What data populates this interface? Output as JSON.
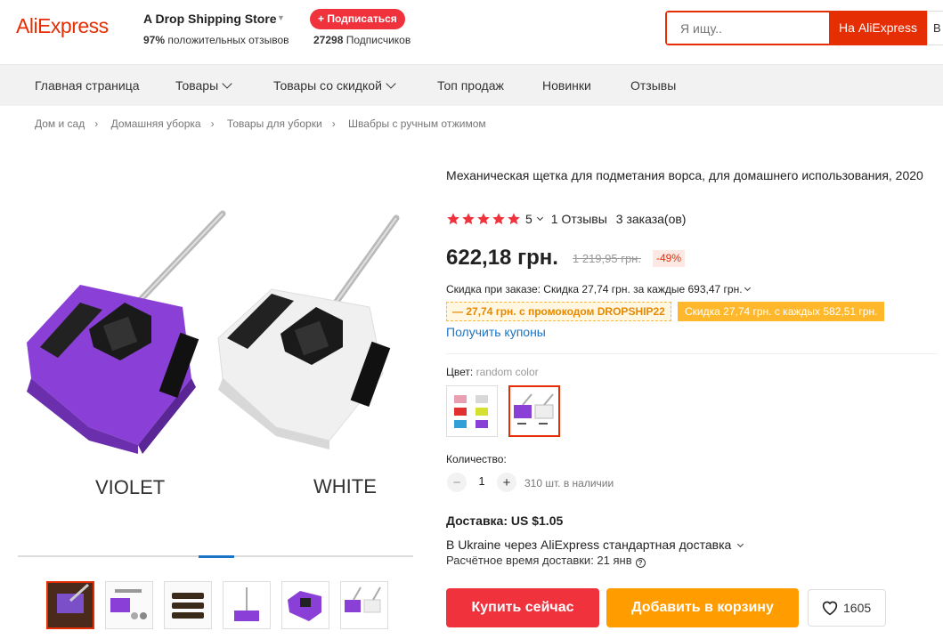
{
  "header": {
    "logo": "AliExpress",
    "store_name": "A Drop Shipping Store",
    "rating_pct": "97%",
    "rating_text": "положительных отзывов",
    "subscribe_label": "+ Подписаться",
    "subscribers_count": "27298",
    "subscribers_text": "Подписчиков",
    "search_placeholder": "Я ищу..",
    "search_button": "На AliExpress",
    "search_button2": "В"
  },
  "nav": {
    "items": [
      "Главная страница",
      "Товары",
      "Товары со скидкой",
      "Топ продаж",
      "Новинки",
      "Отзывы"
    ]
  },
  "breadcrumb": [
    "Дом и сад",
    "Домашняя уборка",
    "Товары для уборки",
    "Швабры с ручным отжимом"
  ],
  "gallery": {
    "main_label_left": "VIOLET",
    "main_label_right": "WHITE",
    "colors": {
      "violet": "#8a3fd6",
      "white": "#f2f2f2"
    }
  },
  "product": {
    "title": "Механическая щетка для подметания ворса, для домашнего использования, 2020",
    "rating": "5",
    "reviews": "1 Отзывы",
    "orders": "3 заказа(ов)",
    "price": "622,18 грн.",
    "old_price": "1 219,95 грн.",
    "discount": "-49%",
    "order_discount": "Скидка при заказе: Скидка 27,74 грн. за каждые 693,47 грн.",
    "promo_code": "— 27,74 грн. с промокодом DROPSHIP22",
    "promo_discount": "Скидка 27,74 грн. с каждых 582,51 грн.",
    "coupons": "Получить купоны",
    "color_label": "Цвет:",
    "color_value": "random color",
    "qty_label": "Количество:",
    "qty_value": "1",
    "qty_minus": "−",
    "qty_plus": "+",
    "stock": "310 шт. в наличии",
    "shipping_title": "Доставка: US $1.05",
    "shipping_line": "В Ukraine через AliExpress стандартная доставка",
    "shipping_est": "Расчётное время доставки: 21 янв",
    "help_icon": "?",
    "buy_now": "Купить сейчас",
    "add_to_cart": "Добавить в корзину",
    "wishlist_count": "1605"
  },
  "accent": {
    "red": "#e62e04",
    "orange": "#ff9c00",
    "link": "#1a75c8"
  }
}
